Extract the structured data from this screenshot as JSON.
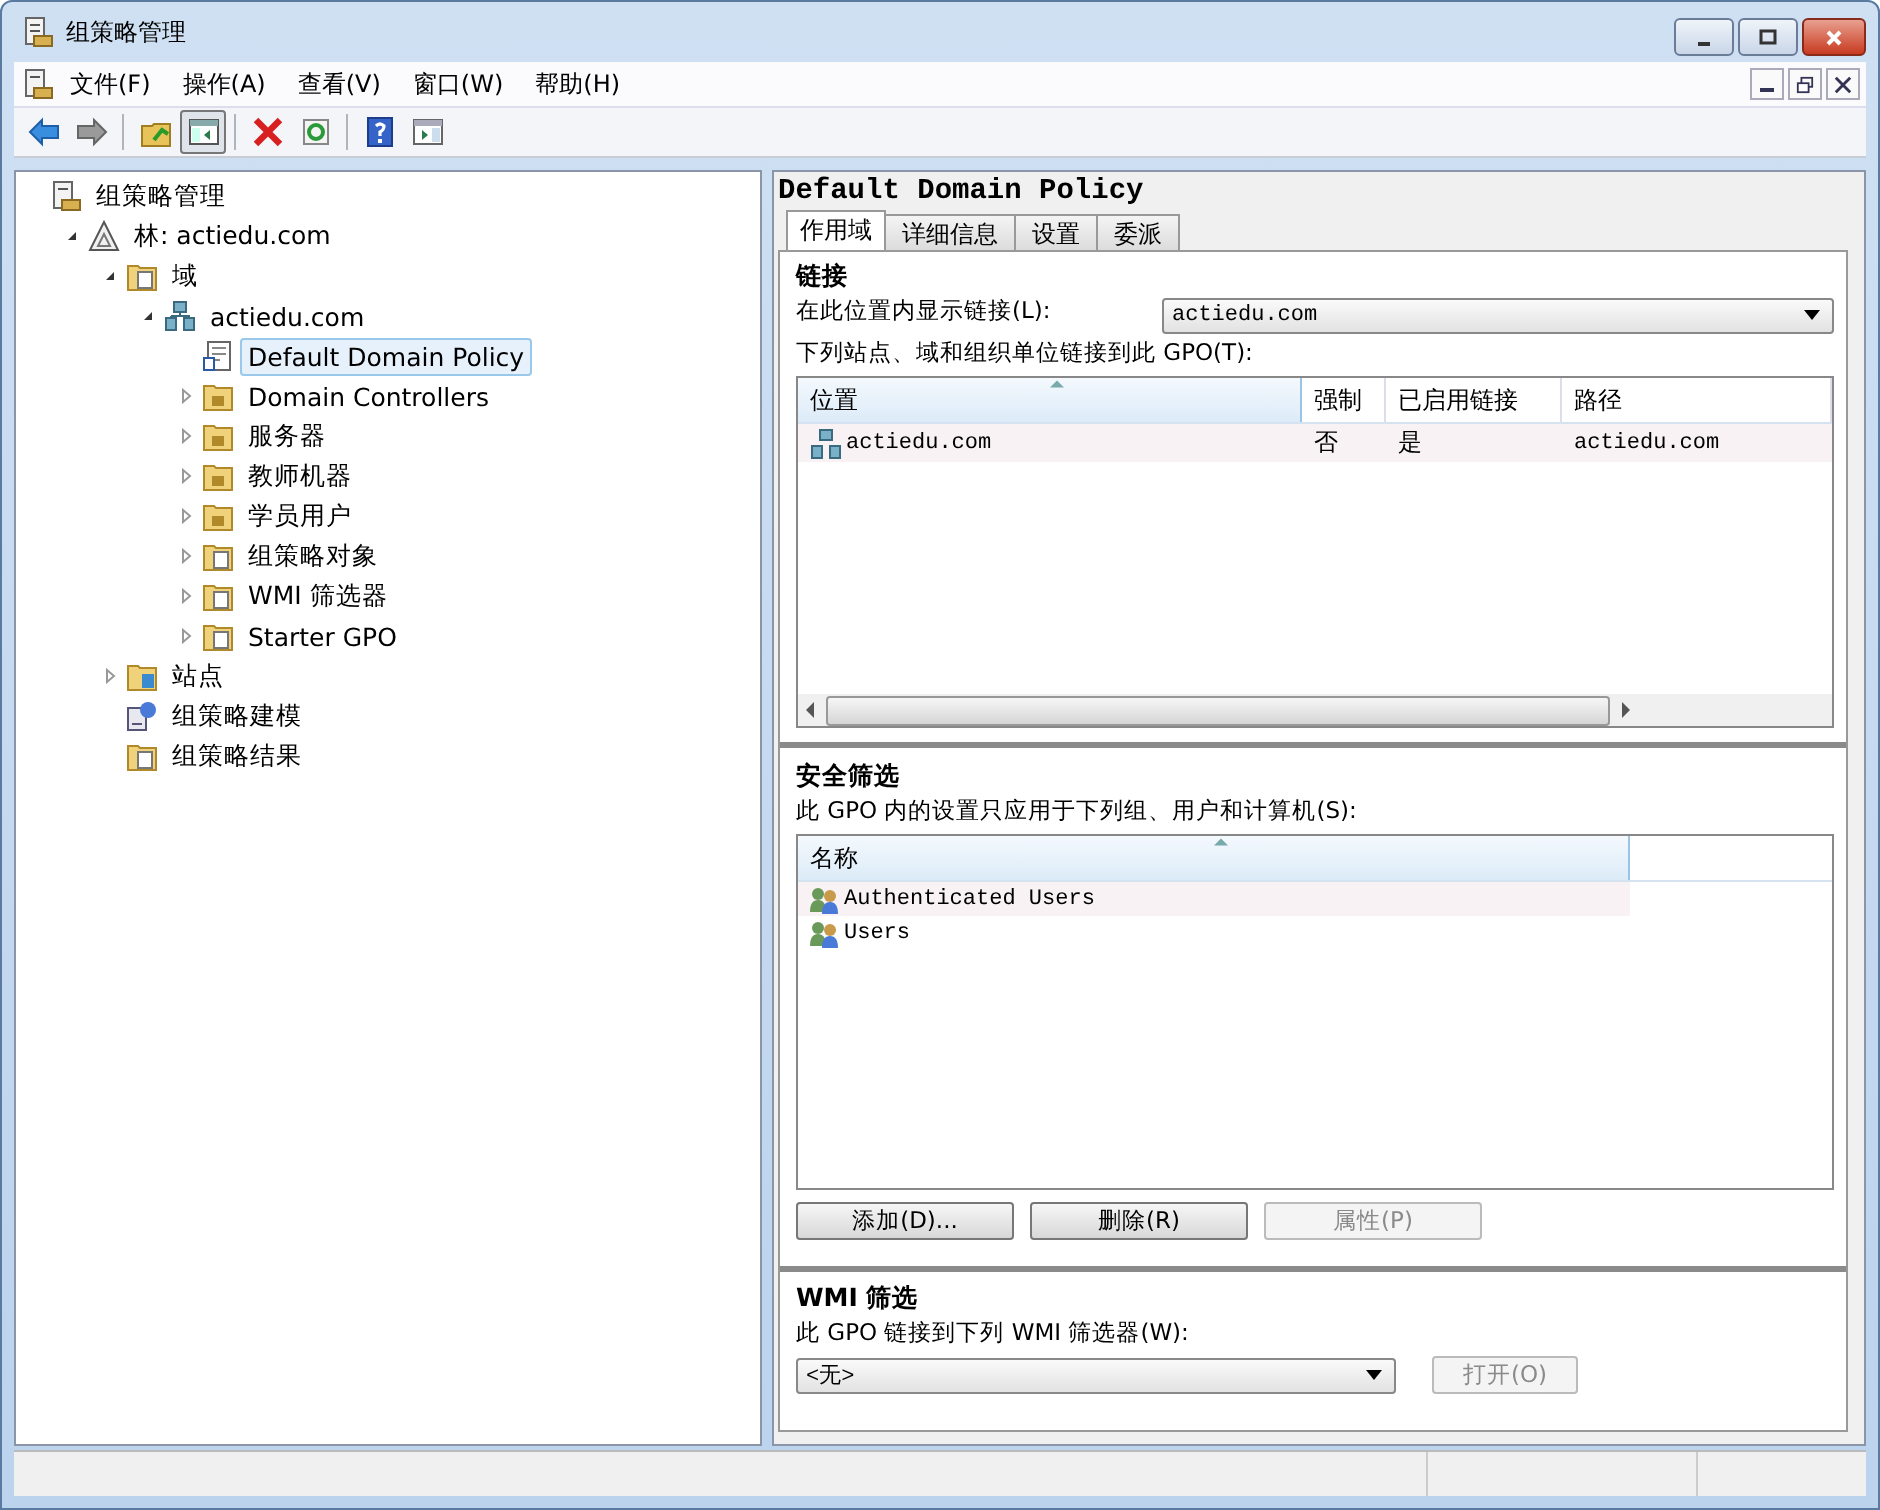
{
  "window": {
    "title": "组策略管理"
  },
  "menu": [
    "文件(F)",
    "操作(A)",
    "查看(V)",
    "窗口(W)",
    "帮助(H)"
  ],
  "toolbar": [
    {
      "pressed": false
    },
    {
      "pressed": false
    },
    {
      "pressed": false
    },
    {
      "pressed": true
    },
    {
      "pressed": false
    },
    {
      "pressed": false
    },
    {
      "pressed": false
    },
    {
      "pressed": false
    }
  ],
  "tree": [
    {
      "label": "组策略管理",
      "kind": "console",
      "selected": false,
      "children": [
        {
          "label": "林: actiedu.com",
          "kind": "forest",
          "expanded": true,
          "selected": false,
          "children": [
            {
              "label": "域",
              "kind": "domains",
              "expanded": true,
              "selected": false,
              "children": [
                {
                  "label": "actiedu.com",
                  "kind": "domain",
                  "expanded": true,
                  "selected": false,
                  "children": [
                    {
                      "label": "Default Domain Policy",
                      "kind": "gpo",
                      "selected": true
                    },
                    {
                      "label": "Domain Controllers",
                      "kind": "ou",
                      "expanded": false,
                      "selected": false
                    },
                    {
                      "label": "服务器",
                      "kind": "ou",
                      "expanded": false,
                      "selected": false
                    },
                    {
                      "label": "教师机器",
                      "kind": "ou",
                      "expanded": false,
                      "selected": false
                    },
                    {
                      "label": "学员用户",
                      "kind": "ou",
                      "expanded": false,
                      "selected": false
                    },
                    {
                      "label": "组策略对象",
                      "kind": "gpo-folder",
                      "expanded": false,
                      "selected": false
                    },
                    {
                      "label": "WMI 筛选器",
                      "kind": "wmi",
                      "expanded": false,
                      "selected": false
                    },
                    {
                      "label": "Starter GPO",
                      "kind": "starter",
                      "expanded": false,
                      "selected": false
                    }
                  ]
                }
              ]
            },
            {
              "label": "站点",
              "kind": "sites",
              "expanded": false,
              "selected": false
            },
            {
              "label": "组策略建模",
              "kind": "modeling",
              "selected": false
            },
            {
              "label": "组策略结果",
              "kind": "results",
              "selected": false
            }
          ]
        }
      ]
    }
  ],
  "detail": {
    "title": "Default Domain Policy",
    "tabs": [
      {
        "label": "作用域",
        "selected": true
      },
      {
        "label": "详细信息",
        "selected": false
      },
      {
        "label": "设置",
        "selected": false
      },
      {
        "label": "委派",
        "selected": false
      }
    ],
    "links": {
      "heading": "链接",
      "location_label": "在此位置内显示链接(L):",
      "location_value": "actiedu.com",
      "list_label": "下列站点、域和组织单位链接到此 GPO(T):",
      "columns": [
        {
          "label": "位置",
          "sorted": true
        },
        {
          "label": "强制",
          "sorted": false
        },
        {
          "label": "已启用链接",
          "sorted": false
        },
        {
          "label": "路径",
          "sorted": false
        }
      ],
      "rows": [
        {
          "location": "actiedu.com",
          "enforced": "否",
          "enabled": "是",
          "path": "actiedu.com"
        }
      ]
    },
    "security": {
      "heading": "安全筛选",
      "label": "此 GPO 内的设置只应用于下列组、用户和计算机(S):",
      "columns": [
        {
          "label": "名称",
          "sorted": true
        }
      ],
      "rows": [
        "Authenticated Users",
        "Users"
      ],
      "buttons": [
        {
          "label": "添加(D)...",
          "disabled": false
        },
        {
          "label": "删除(R)",
          "disabled": false
        },
        {
          "label": "属性(P)",
          "disabled": true
        }
      ]
    },
    "wmi": {
      "heading": "WMI 筛选",
      "label": "此 GPO 链接到下列 WMI 筛选器(W):",
      "value": "<无>",
      "button": {
        "label": "打开(O)",
        "disabled": true
      }
    }
  }
}
